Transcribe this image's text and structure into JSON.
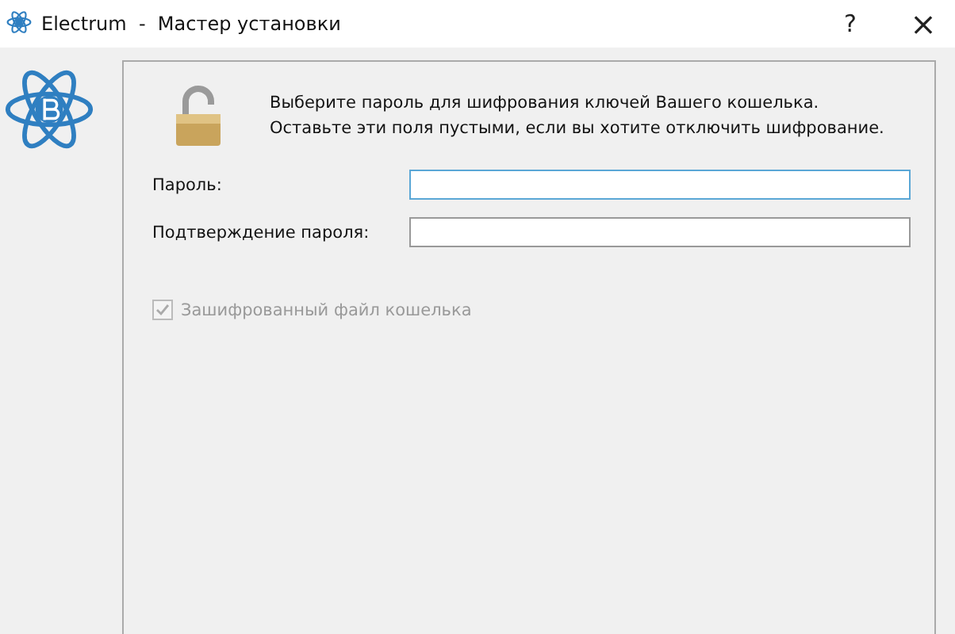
{
  "window": {
    "title": "Electrum  -  Мастер установки",
    "help": "?",
    "close": "×"
  },
  "message": [
    "Выберите пароль для шифрования ключей Вашего кошелька.",
    "Оставьте эти поля пустыми, если вы хотите отключить шифрование."
  ],
  "fields": [
    {
      "label": "Пароль:",
      "focused": true
    },
    {
      "label": "Подтверждение пароля:",
      "focused": false
    }
  ],
  "checkbox": {
    "label": "Зашифрованный файл кошелька",
    "checked": true,
    "disabled": true
  }
}
